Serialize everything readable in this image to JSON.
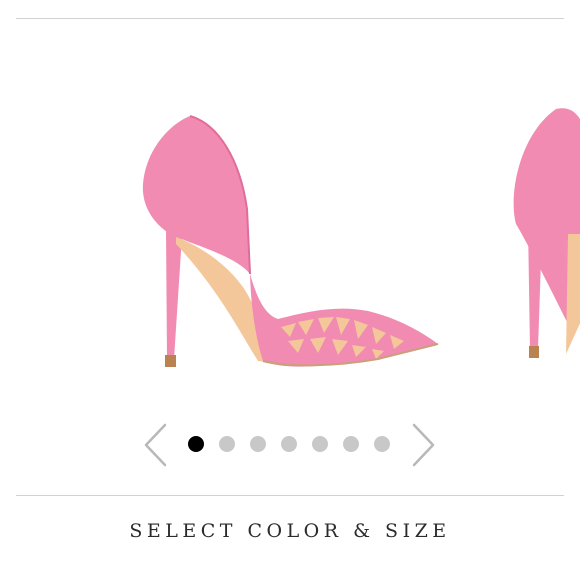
{
  "product_gallery": {
    "images": [
      {
        "icon": "pink-heel-shoe-image",
        "color": "#f18bb2"
      },
      {
        "icon": "pink-heel-shoe-image-next",
        "color": "#f18bb2"
      }
    ],
    "pagination": {
      "total": 7,
      "active_index": 0
    },
    "prev_icon": "chevron-left-icon",
    "next_icon": "chevron-right-icon",
    "colors": {
      "dot_active": "#000000",
      "dot_inactive": "#c8c8c8",
      "arrow": "#b8b8b8",
      "divider": "#d2d2d2"
    }
  },
  "cta": {
    "label": "SELECT COLOR & SIZE",
    "color": "#2b2b2b"
  }
}
